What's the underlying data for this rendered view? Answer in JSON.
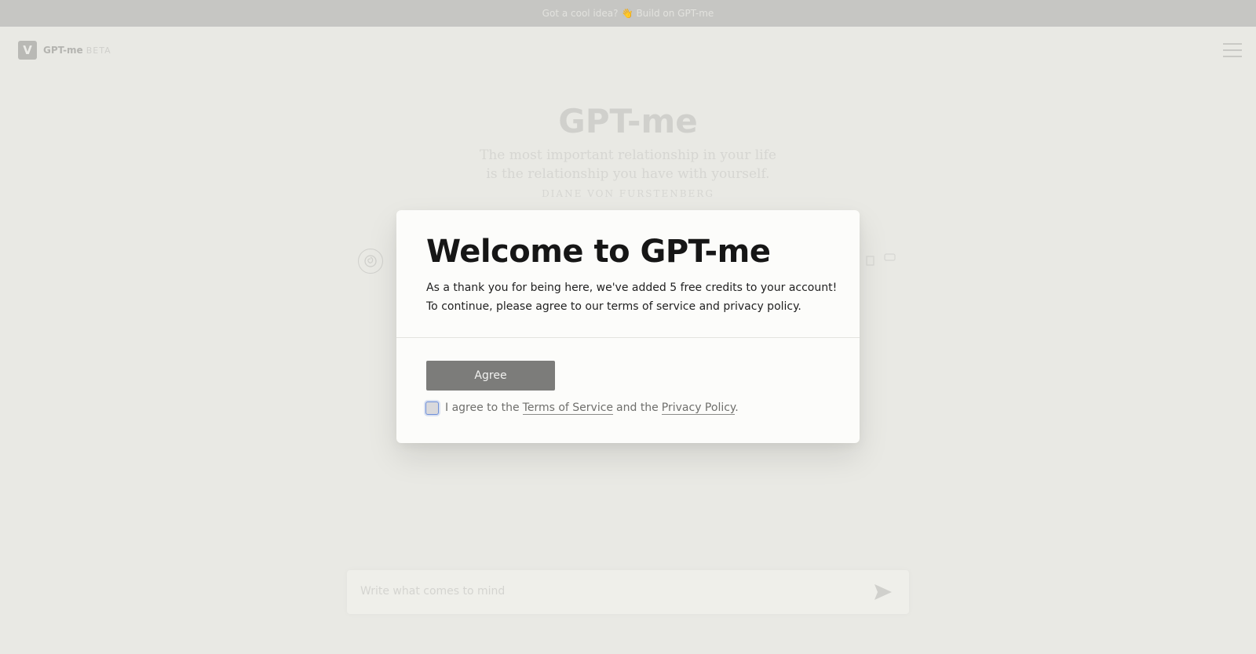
{
  "banner": {
    "text": "Got a cool idea?",
    "hand": "👋",
    "link": "Build on GPT-me"
  },
  "brand": {
    "logo_letter": "V",
    "name": "GPT-me",
    "tag": "BETA"
  },
  "hero": {
    "title": "GPT-me",
    "quote_line1": "The most important relationship in your life",
    "quote_line2": "is the relationship you have with yourself.",
    "author": "DIANE VON FURSTENBERG"
  },
  "composer": {
    "placeholder": "Write what comes to mind"
  },
  "modal": {
    "title": "Welcome to GPT-me",
    "line1": "As a thank you for being here, we've added 5 free credits to your account!",
    "line2": "To continue, please agree to our terms of service and privacy policy.",
    "agree_label": "Agree",
    "consent_prefix": "I agree to the",
    "terms_link": "Terms of Service",
    "consent_middle": "and the",
    "privacy_link": "Privacy Policy",
    "consent_suffix": "."
  },
  "icons": {
    "menu": "hamburger-icon",
    "avatar": "spiral-icon",
    "copy": "copy-icon",
    "comment": "comment-icon",
    "send": "send-icon"
  }
}
